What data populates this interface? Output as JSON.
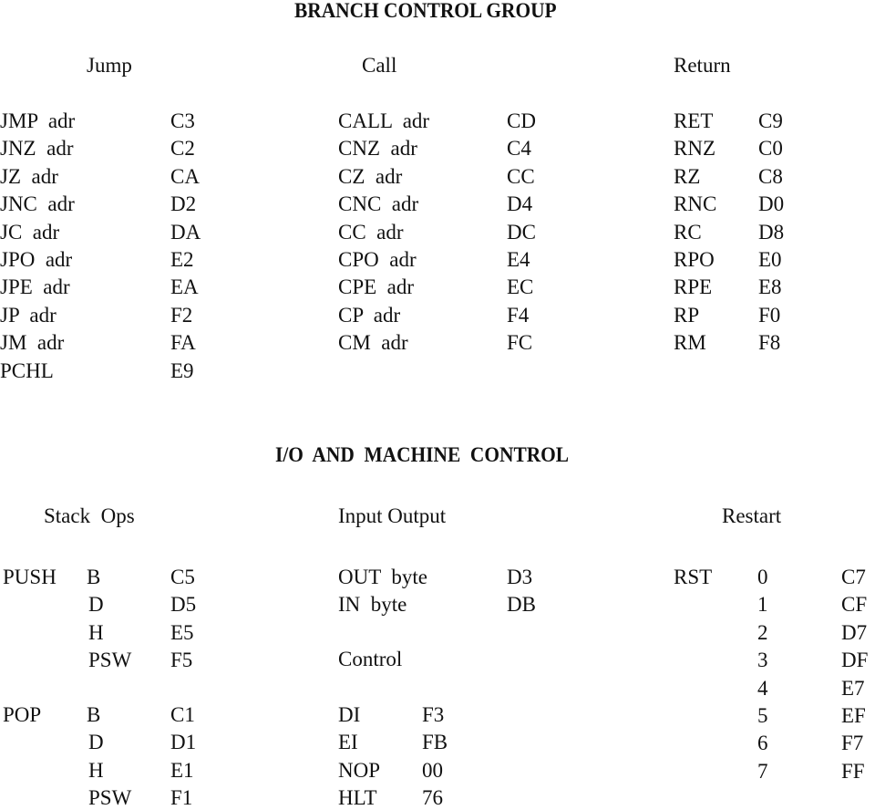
{
  "branch": {
    "title": "BRANCH CONTROL GROUP",
    "headers": {
      "jump": "Jump",
      "call": "Call",
      "return": "Return"
    },
    "jump": [
      {
        "op": "JMP  adr",
        "code": "C3"
      },
      {
        "op": "JNZ  adr",
        "code": "C2"
      },
      {
        "op": "JZ  adr",
        "code": "CA"
      },
      {
        "op": "JNC  adr",
        "code": "D2"
      },
      {
        "op": "JC  adr",
        "code": "DA"
      },
      {
        "op": "JPO  adr",
        "code": "E2"
      },
      {
        "op": "JPE  adr",
        "code": "EA"
      },
      {
        "op": "JP  adr",
        "code": "F2"
      },
      {
        "op": "JM  adr",
        "code": "FA"
      },
      {
        "op": "PCHL",
        "code": "E9"
      }
    ],
    "call": [
      {
        "op": "CALL  adr",
        "code": "CD"
      },
      {
        "op": "CNZ  adr",
        "code": "C4"
      },
      {
        "op": "CZ  adr",
        "code": "CC"
      },
      {
        "op": "CNC  adr",
        "code": "D4"
      },
      {
        "op": "CC  adr",
        "code": "DC"
      },
      {
        "op": "CPO  adr",
        "code": "E4"
      },
      {
        "op": "CPE  adr",
        "code": "EC"
      },
      {
        "op": "CP  adr",
        "code": "F4"
      },
      {
        "op": "CM  adr",
        "code": "FC"
      }
    ],
    "return": [
      {
        "op": "RET",
        "code": "C9"
      },
      {
        "op": "RNZ",
        "code": "C0"
      },
      {
        "op": "RZ",
        "code": "C8"
      },
      {
        "op": "RNC",
        "code": "D0"
      },
      {
        "op": "RC",
        "code": "D8"
      },
      {
        "op": "RPO",
        "code": "E0"
      },
      {
        "op": "RPE",
        "code": "E8"
      },
      {
        "op": "RP",
        "code": "F0"
      },
      {
        "op": "RM",
        "code": "F8"
      }
    ]
  },
  "io": {
    "title": "I/O  AND  MACHINE  CONTROL",
    "headers": {
      "stack": "Stack  Ops",
      "io": "Input Output",
      "restart": "Restart"
    },
    "push": {
      "op": "PUSH",
      "rows": [
        {
          "reg": "B",
          "code": "C5"
        },
        {
          "reg": "D",
          "code": "D5"
        },
        {
          "reg": "H",
          "code": "E5"
        },
        {
          "reg": "PSW",
          "code": "F5"
        }
      ]
    },
    "pop": {
      "op": "POP",
      "rows": [
        {
          "reg": "B",
          "code": "C1"
        },
        {
          "reg": "D",
          "code": "D1"
        },
        {
          "reg": "H",
          "code": "E1"
        },
        {
          "reg": "PSW",
          "code": "F1"
        }
      ]
    },
    "inout": [
      {
        "op": "OUT  byte",
        "code": "D3"
      },
      {
        "op": "IN  byte",
        "code": "DB"
      }
    ],
    "control_label": "Control",
    "control": [
      {
        "op": "DI",
        "code": "F3"
      },
      {
        "op": "EI",
        "code": "FB"
      },
      {
        "op": "NOP",
        "code": "00"
      },
      {
        "op": "HLT",
        "code": "76"
      }
    ],
    "restart": {
      "op": "RST",
      "rows": [
        {
          "n": "0",
          "code": "C7"
        },
        {
          "n": "1",
          "code": "CF"
        },
        {
          "n": "2",
          "code": "D7"
        },
        {
          "n": "3",
          "code": "DF"
        },
        {
          "n": "4",
          "code": "E7"
        },
        {
          "n": "5",
          "code": "EF"
        },
        {
          "n": "6",
          "code": "F7"
        },
        {
          "n": "7",
          "code": "FF"
        }
      ]
    }
  }
}
